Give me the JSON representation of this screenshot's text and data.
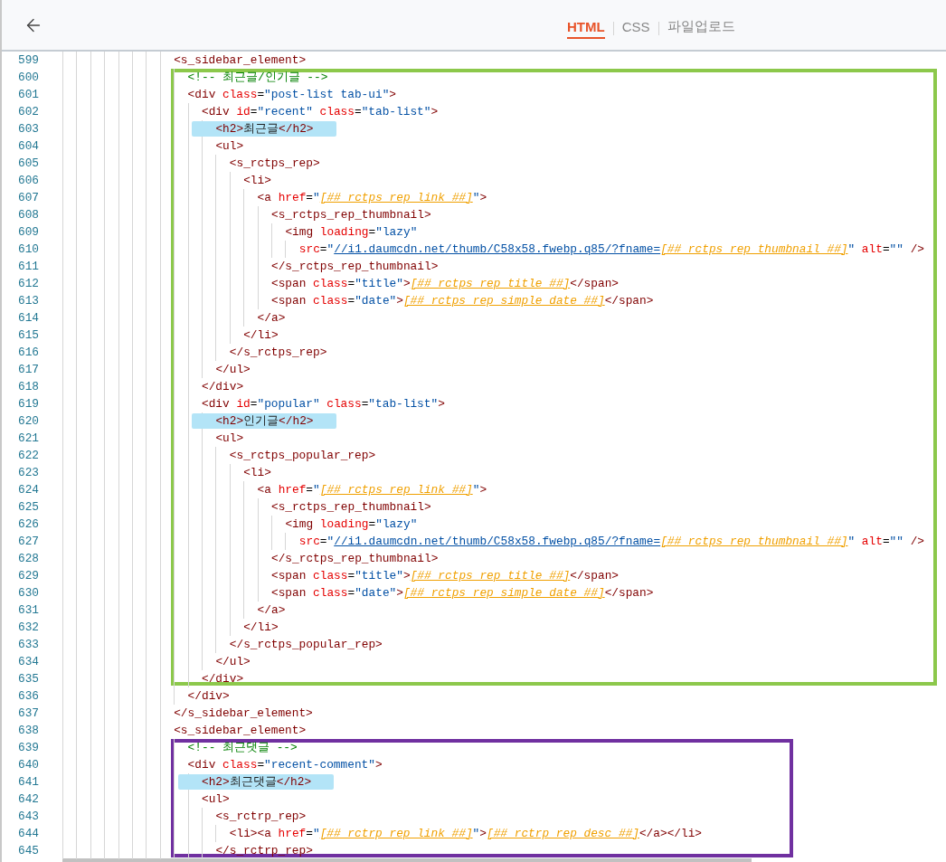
{
  "header": {
    "tabs": [
      {
        "label": "HTML",
        "selected": true
      },
      {
        "label": "CSS",
        "selected": false
      },
      {
        "label": "파일업로드",
        "selected": false
      }
    ]
  },
  "code": [
    {
      "kind": "line",
      "no": "599",
      "highlighted": false,
      "tokens": [
        {
          "kind": "tag",
          "text": "<s_sidebar_element>"
        }
      ],
      "children": [
        {
          "kind": "frame",
          "color": "#8cc84b",
          "children": [
            {
              "kind": "line",
              "no": "600",
              "highlighted": false,
              "tokens": [
                {
                  "kind": "comment",
                  "text": "<!-- 최근글/인기글 -->"
                }
              ]
            },
            {
              "kind": "line",
              "no": "601",
              "highlighted": false,
              "tokens": [
                {
                  "kind": "tag",
                  "text": "<div"
                },
                {
                  "kind": "attr",
                  "text": " class"
                },
                {
                  "kind": "punct",
                  "text": "="
                },
                {
                  "kind": "str",
                  "text": "\"post-list tab-ui\""
                },
                {
                  "kind": "tag",
                  "text": ">"
                }
              ],
              "children": [
                {
                  "kind": "line",
                  "no": "602",
                  "highlighted": false,
                  "tokens": [
                    {
                      "kind": "tag",
                      "text": "<div"
                    },
                    {
                      "kind": "attr",
                      "text": " id"
                    },
                    {
                      "kind": "punct",
                      "text": "="
                    },
                    {
                      "kind": "str",
                      "text": "\"recent\""
                    },
                    {
                      "kind": "attr",
                      "text": " class"
                    },
                    {
                      "kind": "punct",
                      "text": "="
                    },
                    {
                      "kind": "str",
                      "text": "\"tab-list\""
                    },
                    {
                      "kind": "tag",
                      "text": ">"
                    }
                  ],
                  "children": [
                    {
                      "kind": "line",
                      "no": "603",
                      "highlighted": true,
                      "tokens": [
                        {
                          "kind": "tag",
                          "text": "<h2>"
                        },
                        {
                          "kind": "text",
                          "text": "최근글"
                        },
                        {
                          "kind": "tag",
                          "text": "</h2>"
                        }
                      ]
                    },
                    {
                      "kind": "line",
                      "no": "604",
                      "highlighted": false,
                      "tokens": [
                        {
                          "kind": "tag",
                          "text": "<ul>"
                        }
                      ],
                      "children": [
                        {
                          "kind": "line",
                          "no": "605",
                          "highlighted": false,
                          "tokens": [
                            {
                              "kind": "tag",
                              "text": "<s_rctps_rep>"
                            }
                          ],
                          "children": [
                            {
                              "kind": "line",
                              "no": "606",
                              "highlighted": false,
                              "tokens": [
                                {
                                  "kind": "tag",
                                  "text": "<li>"
                                }
                              ],
                              "children": [
                                {
                                  "kind": "line",
                                  "no": "607",
                                  "highlighted": false,
                                  "tokens": [
                                    {
                                      "kind": "tag",
                                      "text": "<a"
                                    },
                                    {
                                      "kind": "attr",
                                      "text": " href"
                                    },
                                    {
                                      "kind": "punct",
                                      "text": "="
                                    },
                                    {
                                      "kind": "str",
                                      "text": "\""
                                    },
                                    {
                                      "kind": "ph",
                                      "text": "[##_rctps_rep_link_##]"
                                    },
                                    {
                                      "kind": "str",
                                      "text": "\""
                                    },
                                    {
                                      "kind": "tag",
                                      "text": ">"
                                    }
                                  ],
                                  "children": [
                                    {
                                      "kind": "line",
                                      "no": "608",
                                      "highlighted": false,
                                      "tokens": [
                                        {
                                          "kind": "tag",
                                          "text": "<s_rctps_rep_thumbnail>"
                                        }
                                      ],
                                      "children": [
                                        {
                                          "kind": "line",
                                          "no": "609",
                                          "highlighted": false,
                                          "tokens": [
                                            {
                                              "kind": "tag",
                                              "text": "<img"
                                            },
                                            {
                                              "kind": "attr",
                                              "text": " loading"
                                            },
                                            {
                                              "kind": "punct",
                                              "text": "="
                                            },
                                            {
                                              "kind": "str",
                                              "text": "\"lazy\""
                                            }
                                          ],
                                          "children": [
                                            {
                                              "kind": "line",
                                              "no": "610",
                                              "highlighted": false,
                                              "tokens": [
                                                {
                                                  "kind": "attr",
                                                  "text": "src"
                                                },
                                                {
                                                  "kind": "punct",
                                                  "text": "="
                                                },
                                                {
                                                  "kind": "str",
                                                  "text": "\""
                                                },
                                                {
                                                  "kind": "link",
                                                  "text": "//i1.daumcdn.net/thumb/C58x58.fwebp.q85/?fname="
                                                },
                                                {
                                                  "kind": "ph",
                                                  "text": "[##_rctps_rep_thumbnail_##]"
                                                },
                                                {
                                                  "kind": "str",
                                                  "text": "\""
                                                },
                                                {
                                                  "kind": "attr",
                                                  "text": " alt"
                                                },
                                                {
                                                  "kind": "punct",
                                                  "text": "="
                                                },
                                                {
                                                  "kind": "str",
                                                  "text": "\"\""
                                                },
                                                {
                                                  "kind": "tag",
                                                  "text": " />"
                                                }
                                              ]
                                            }
                                          ]
                                        }
                                      ]
                                    },
                                    {
                                      "kind": "line",
                                      "no": "611",
                                      "highlighted": false,
                                      "tokens": [
                                        {
                                          "kind": "tag",
                                          "text": "</s_rctps_rep_thumbnail>"
                                        }
                                      ]
                                    },
                                    {
                                      "kind": "line",
                                      "no": "612",
                                      "highlighted": false,
                                      "tokens": [
                                        {
                                          "kind": "tag",
                                          "text": "<span"
                                        },
                                        {
                                          "kind": "attr",
                                          "text": " class"
                                        },
                                        {
                                          "kind": "punct",
                                          "text": "="
                                        },
                                        {
                                          "kind": "str",
                                          "text": "\"title\""
                                        },
                                        {
                                          "kind": "tag",
                                          "text": ">"
                                        },
                                        {
                                          "kind": "ph",
                                          "text": "[##_rctps_rep_title_##]"
                                        },
                                        {
                                          "kind": "tag",
                                          "text": "</span>"
                                        }
                                      ]
                                    },
                                    {
                                      "kind": "line",
                                      "no": "613",
                                      "highlighted": false,
                                      "tokens": [
                                        {
                                          "kind": "tag",
                                          "text": "<span"
                                        },
                                        {
                                          "kind": "attr",
                                          "text": " class"
                                        },
                                        {
                                          "kind": "punct",
                                          "text": "="
                                        },
                                        {
                                          "kind": "str",
                                          "text": "\"date\""
                                        },
                                        {
                                          "kind": "tag",
                                          "text": ">"
                                        },
                                        {
                                          "kind": "ph",
                                          "text": "[##_rctps_rep_simple_date_##]"
                                        },
                                        {
                                          "kind": "tag",
                                          "text": "</span>"
                                        }
                                      ]
                                    }
                                  ]
                                },
                                {
                                  "kind": "line",
                                  "no": "614",
                                  "highlighted": false,
                                  "tokens": [
                                    {
                                      "kind": "tag",
                                      "text": "</a>"
                                    }
                                  ]
                                }
                              ]
                            },
                            {
                              "kind": "line",
                              "no": "615",
                              "highlighted": false,
                              "tokens": [
                                {
                                  "kind": "tag",
                                  "text": "</li>"
                                }
                              ]
                            }
                          ]
                        },
                        {
                          "kind": "line",
                          "no": "616",
                          "highlighted": false,
                          "tokens": [
                            {
                              "kind": "tag",
                              "text": "</s_rctps_rep>"
                            }
                          ]
                        }
                      ]
                    },
                    {
                      "kind": "line",
                      "no": "617",
                      "highlighted": false,
                      "tokens": [
                        {
                          "kind": "tag",
                          "text": "</ul>"
                        }
                      ]
                    }
                  ]
                },
                {
                  "kind": "line",
                  "no": "618",
                  "highlighted": false,
                  "tokens": [
                    {
                      "kind": "tag",
                      "text": "</div>"
                    }
                  ]
                },
                {
                  "kind": "line",
                  "no": "619",
                  "highlighted": false,
                  "tokens": [
                    {
                      "kind": "tag",
                      "text": "<div"
                    },
                    {
                      "kind": "attr",
                      "text": " id"
                    },
                    {
                      "kind": "punct",
                      "text": "="
                    },
                    {
                      "kind": "str",
                      "text": "\"popular\""
                    },
                    {
                      "kind": "attr",
                      "text": " class"
                    },
                    {
                      "kind": "punct",
                      "text": "="
                    },
                    {
                      "kind": "str",
                      "text": "\"tab-list\""
                    },
                    {
                      "kind": "tag",
                      "text": ">"
                    }
                  ],
                  "children": [
                    {
                      "kind": "line",
                      "no": "620",
                      "highlighted": true,
                      "tokens": [
                        {
                          "kind": "tag",
                          "text": "<h2>"
                        },
                        {
                          "kind": "text",
                          "text": "인기글"
                        },
                        {
                          "kind": "tag",
                          "text": "</h2>"
                        }
                      ]
                    },
                    {
                      "kind": "line",
                      "no": "621",
                      "highlighted": false,
                      "tokens": [
                        {
                          "kind": "tag",
                          "text": "<ul>"
                        }
                      ],
                      "children": [
                        {
                          "kind": "line",
                          "no": "622",
                          "highlighted": false,
                          "tokens": [
                            {
                              "kind": "tag",
                              "text": "<s_rctps_popular_rep>"
                            }
                          ],
                          "children": [
                            {
                              "kind": "line",
                              "no": "623",
                              "highlighted": false,
                              "tokens": [
                                {
                                  "kind": "tag",
                                  "text": "<li>"
                                }
                              ],
                              "children": [
                                {
                                  "kind": "line",
                                  "no": "624",
                                  "highlighted": false,
                                  "tokens": [
                                    {
                                      "kind": "tag",
                                      "text": "<a"
                                    },
                                    {
                                      "kind": "attr",
                                      "text": " href"
                                    },
                                    {
                                      "kind": "punct",
                                      "text": "="
                                    },
                                    {
                                      "kind": "str",
                                      "text": "\""
                                    },
                                    {
                                      "kind": "ph",
                                      "text": "[##_rctps_rep_link_##]"
                                    },
                                    {
                                      "kind": "str",
                                      "text": "\""
                                    },
                                    {
                                      "kind": "tag",
                                      "text": ">"
                                    }
                                  ],
                                  "children": [
                                    {
                                      "kind": "line",
                                      "no": "625",
                                      "highlighted": false,
                                      "tokens": [
                                        {
                                          "kind": "tag",
                                          "text": "<s_rctps_rep_thumbnail>"
                                        }
                                      ],
                                      "children": [
                                        {
                                          "kind": "line",
                                          "no": "626",
                                          "highlighted": false,
                                          "tokens": [
                                            {
                                              "kind": "tag",
                                              "text": "<img"
                                            },
                                            {
                                              "kind": "attr",
                                              "text": " loading"
                                            },
                                            {
                                              "kind": "punct",
                                              "text": "="
                                            },
                                            {
                                              "kind": "str",
                                              "text": "\"lazy\""
                                            }
                                          ],
                                          "children": [
                                            {
                                              "kind": "line",
                                              "no": "627",
                                              "highlighted": false,
                                              "tokens": [
                                                {
                                                  "kind": "attr",
                                                  "text": "src"
                                                },
                                                {
                                                  "kind": "punct",
                                                  "text": "="
                                                },
                                                {
                                                  "kind": "str",
                                                  "text": "\""
                                                },
                                                {
                                                  "kind": "link",
                                                  "text": "//i1.daumcdn.net/thumb/C58x58.fwebp.q85/?fname="
                                                },
                                                {
                                                  "kind": "ph",
                                                  "text": "[##_rctps_rep_thumbnail_##]"
                                                },
                                                {
                                                  "kind": "str",
                                                  "text": "\""
                                                },
                                                {
                                                  "kind": "attr",
                                                  "text": " alt"
                                                },
                                                {
                                                  "kind": "punct",
                                                  "text": "="
                                                },
                                                {
                                                  "kind": "str",
                                                  "text": "\"\""
                                                },
                                                {
                                                  "kind": "tag",
                                                  "text": " />"
                                                }
                                              ]
                                            }
                                          ]
                                        }
                                      ]
                                    },
                                    {
                                      "kind": "line",
                                      "no": "628",
                                      "highlighted": false,
                                      "tokens": [
                                        {
                                          "kind": "tag",
                                          "text": "</s_rctps_rep_thumbnail>"
                                        }
                                      ]
                                    },
                                    {
                                      "kind": "line",
                                      "no": "629",
                                      "highlighted": false,
                                      "tokens": [
                                        {
                                          "kind": "tag",
                                          "text": "<span"
                                        },
                                        {
                                          "kind": "attr",
                                          "text": " class"
                                        },
                                        {
                                          "kind": "punct",
                                          "text": "="
                                        },
                                        {
                                          "kind": "str",
                                          "text": "\"title\""
                                        },
                                        {
                                          "kind": "tag",
                                          "text": ">"
                                        },
                                        {
                                          "kind": "ph",
                                          "text": "[##_rctps_rep_title_##]"
                                        },
                                        {
                                          "kind": "tag",
                                          "text": "</span>"
                                        }
                                      ]
                                    },
                                    {
                                      "kind": "line",
                                      "no": "630",
                                      "highlighted": false,
                                      "tokens": [
                                        {
                                          "kind": "tag",
                                          "text": "<span"
                                        },
                                        {
                                          "kind": "attr",
                                          "text": " class"
                                        },
                                        {
                                          "kind": "punct",
                                          "text": "="
                                        },
                                        {
                                          "kind": "str",
                                          "text": "\"date\""
                                        },
                                        {
                                          "kind": "tag",
                                          "text": ">"
                                        },
                                        {
                                          "kind": "ph",
                                          "text": "[##_rctps_rep_simple_date_##]"
                                        },
                                        {
                                          "kind": "tag",
                                          "text": "</span>"
                                        }
                                      ]
                                    }
                                  ]
                                },
                                {
                                  "kind": "line",
                                  "no": "631",
                                  "highlighted": false,
                                  "tokens": [
                                    {
                                      "kind": "tag",
                                      "text": "</a>"
                                    }
                                  ]
                                }
                              ]
                            },
                            {
                              "kind": "line",
                              "no": "632",
                              "highlighted": false,
                              "tokens": [
                                {
                                  "kind": "tag",
                                  "text": "</li>"
                                }
                              ]
                            }
                          ]
                        },
                        {
                          "kind": "line",
                          "no": "633",
                          "highlighted": false,
                          "tokens": [
                            {
                              "kind": "tag",
                              "text": "</s_rctps_popular_rep>"
                            }
                          ]
                        }
                      ]
                    },
                    {
                      "kind": "line",
                      "no": "634",
                      "highlighted": false,
                      "tokens": [
                        {
                          "kind": "tag",
                          "text": "</ul>"
                        }
                      ]
                    }
                  ]
                },
                {
                  "kind": "line",
                  "no": "635",
                  "highlighted": false,
                  "tokens": [
                    {
                      "kind": "tag",
                      "text": "</div>"
                    }
                  ]
                }
              ]
            }
          ]
        },
        {
          "kind": "line",
          "no": "636",
          "highlighted": false,
          "tokens": [
            {
              "kind": "tag",
              "text": "</div>"
            }
          ]
        }
      ]
    },
    {
      "kind": "line",
      "no": "637",
      "highlighted": false,
      "tokens": [
        {
          "kind": "tag",
          "text": "</s_sidebar_element>"
        }
      ]
    },
    {
      "kind": "line",
      "no": "638",
      "highlighted": false,
      "tokens": [
        {
          "kind": "tag",
          "text": "<s_sidebar_element>"
        }
      ],
      "children": [
        {
          "kind": "frame",
          "color": "#7030a0",
          "children": [
            {
              "kind": "line",
              "no": "639",
              "highlighted": false,
              "tokens": [
                {
                  "kind": "comment",
                  "text": "<!-- 최근댓글 -->"
                }
              ]
            },
            {
              "kind": "line",
              "no": "640",
              "highlighted": false,
              "tokens": [
                {
                  "kind": "tag",
                  "text": "<div"
                },
                {
                  "kind": "attr",
                  "text": " class"
                },
                {
                  "kind": "punct",
                  "text": "="
                },
                {
                  "kind": "str",
                  "text": "\"recent-comment\""
                },
                {
                  "kind": "tag",
                  "text": ">"
                }
              ],
              "children": [
                {
                  "kind": "line",
                  "no": "641",
                  "highlighted": true,
                  "tokens": [
                    {
                      "kind": "tag",
                      "text": "<h2>"
                    },
                    {
                      "kind": "text",
                      "text": "최근댓글"
                    },
                    {
                      "kind": "tag",
                      "text": "</h2>"
                    }
                  ]
                },
                {
                  "kind": "line",
                  "no": "642",
                  "highlighted": false,
                  "tokens": [
                    {
                      "kind": "tag",
                      "text": "<ul>"
                    }
                  ],
                  "children": [
                    {
                      "kind": "line",
                      "no": "643",
                      "highlighted": false,
                      "tokens": [
                        {
                          "kind": "tag",
                          "text": "<s_rctrp_rep>"
                        }
                      ],
                      "children": [
                        {
                          "kind": "line",
                          "no": "644",
                          "highlighted": false,
                          "tokens": [
                            {
                              "kind": "tag",
                              "text": "<li><a"
                            },
                            {
                              "kind": "attr",
                              "text": " href"
                            },
                            {
                              "kind": "punct",
                              "text": "="
                            },
                            {
                              "kind": "str",
                              "text": "\""
                            },
                            {
                              "kind": "ph",
                              "text": "[##_rctrp_rep_link_##]"
                            },
                            {
                              "kind": "str",
                              "text": "\""
                            },
                            {
                              "kind": "tag",
                              "text": ">"
                            },
                            {
                              "kind": "ph",
                              "text": "[##_rctrp_rep_desc_##]"
                            },
                            {
                              "kind": "tag",
                              "text": "</a></li>"
                            }
                          ]
                        }
                      ]
                    },
                    {
                      "kind": "line",
                      "no": "645",
                      "highlighted": false,
                      "tokens": [
                        {
                          "kind": "tag",
                          "text": "</s_rctrp_rep>"
                        }
                      ]
                    }
                  ]
                }
              ]
            }
          ]
        }
      ]
    }
  ]
}
